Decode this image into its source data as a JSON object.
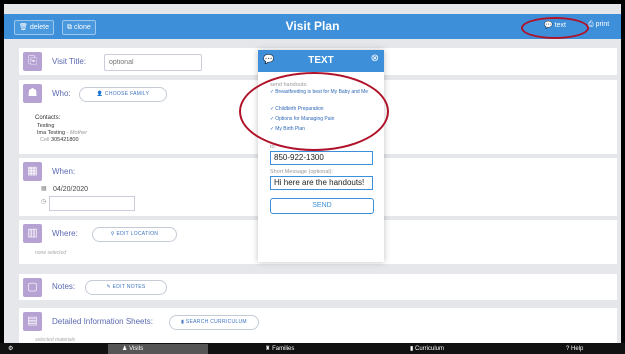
{
  "header": {
    "delete_label": "delete",
    "clone_label": "clone",
    "title": "Visit Plan",
    "text_label": "text",
    "print_label": "print"
  },
  "visit_title": {
    "label": "Visit Title:",
    "placeholder": "optional"
  },
  "who": {
    "label": "Who:",
    "choose_family": "CHOOSE FAMILY",
    "contacts_label": "Contacts:",
    "contact1": "Testing",
    "contact2_name": "Ima Testing",
    "contact2_role": "- Mother",
    "contact2_cell_label": "Cell",
    "contact2_cell": "305421800"
  },
  "when": {
    "label": "When:",
    "date": "04/20/2020"
  },
  "where": {
    "label": "Where:",
    "edit_location": "EDIT LOCATION",
    "none_selected": "none selected"
  },
  "notes": {
    "label": "Notes:",
    "edit_notes": "EDIT NOTES"
  },
  "sheets": {
    "label": "Detailed Information Sheets:",
    "search_curriculum": "SEARCH CURRICULUM",
    "selected": "selected materials"
  },
  "modal": {
    "title": "TEXT",
    "send_handouts_label": "send handouts:",
    "handouts": [
      "Breastfeeding is best for My Baby and Me",
      "Childbirth Preparation",
      "Options for Managing Pain",
      "My Birth Plan"
    ],
    "to_label": "to:",
    "to_value": "850-922-1300",
    "message_label": "Short Message (optional):",
    "message_value": "Hi here are the handouts!",
    "send_label": "SEND"
  },
  "footer": {
    "tabs": [
      "Visits",
      "Families",
      "Curriculum",
      "Help"
    ]
  },
  "colors": {
    "accent": "#3d8fd9",
    "annotation": "#b0122a",
    "badge": "#b6a2d3"
  }
}
